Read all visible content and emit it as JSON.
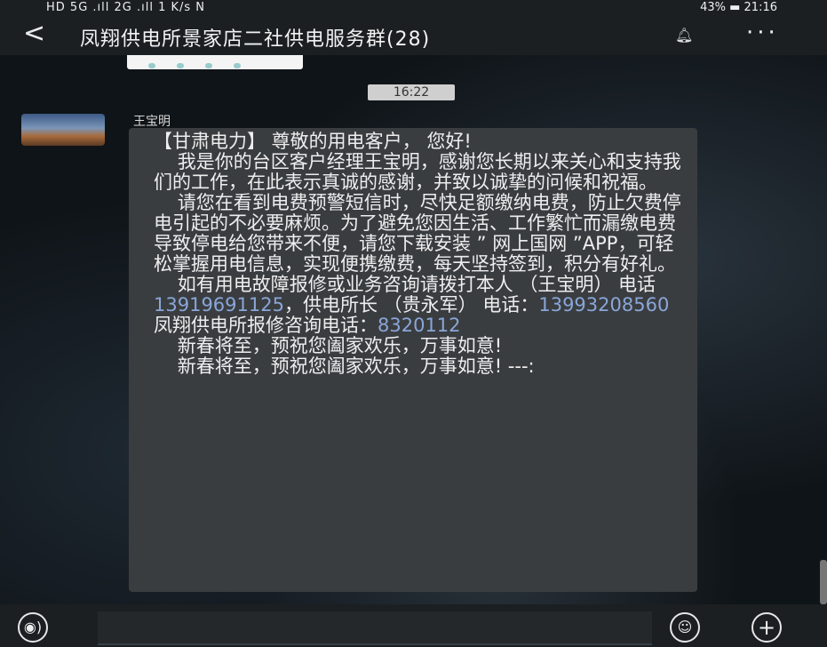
{
  "status_bar": {
    "left_text": "HD 5G .ıll 2G .ıll 1 K/s N",
    "battery": "43%",
    "time": "21:16"
  },
  "header": {
    "back_icon": "back-chevron-icon",
    "title": "凤翔供电所景家店二社供电服务群(28)",
    "mute_icon": "bell-muted-icon",
    "more_icon": "more-dots-icon"
  },
  "timestamp": "16:22",
  "message": {
    "sender": "王宝明",
    "p1": "【甘肃电力】 尊敬的用电客户， 您好!",
    "p2": "    我是你的台区客户经理王宝明，感谢您长期以来关心和支持我们的工作，在此表示真诚的感谢，并致以诚挚的问候和祝福。",
    "p3": "    请您在看到电费预警短信时，尽快足额缴纳电费，防止欠费停电引起的不必要麻烦。为了避免您因生活、工作繁忙而漏缴电费导致停电给您带来不便，请您下载安装 ” 网上国网 ”APP，可轻松掌握用电信息，实现便携缴费，每天坚持签到，积分有好礼。",
    "p4_pre": "    如有用电故障报修或业务咨询请拨打本人 （王宝明） 电话 ",
    "phone1": "13919691125",
    "p4_mid1": "，供电所长 （贵永军） 电话：",
    "phone2": "13993208560",
    "p4_mid2": " 凤翔供电所报修咨询电话：",
    "phone3": "8320112",
    "p5": "    新春将至，预祝您阖家欢乐，万事如意!",
    "p6": "    新春将至，预祝您阖家欢乐，万事如意! ---:"
  },
  "input_bar": {
    "voice_icon": "voice-icon",
    "emoji_icon": "emoji-icon",
    "plus_icon": "plus-icon",
    "placeholder": ""
  }
}
